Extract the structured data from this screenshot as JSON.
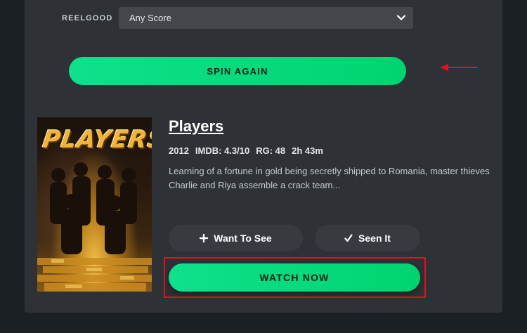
{
  "filter": {
    "label": "REELGOOD",
    "selected": "Any Score"
  },
  "spin": {
    "label": "SPIN AGAIN"
  },
  "movie": {
    "title": "Players",
    "poster_text": "PLAYERS",
    "year": "2012",
    "imdb": "IMDB: 4.3/10",
    "rg": "RG: 48",
    "runtime": "2h 43m",
    "description": "Learning of a fortune in gold being secretly shipped to Romania, master thieves Charlie and Riya assemble a crack team..."
  },
  "actions": {
    "want_label": "Want To See",
    "want_icon": "plus-icon",
    "seen_label": "Seen It",
    "seen_icon": "check-icon",
    "watch_label": "WATCH NOW"
  },
  "colors": {
    "accent": "#00d46f",
    "annotation_red": "#e3101f",
    "panel": "#2e3236",
    "background": "#1b2024"
  }
}
